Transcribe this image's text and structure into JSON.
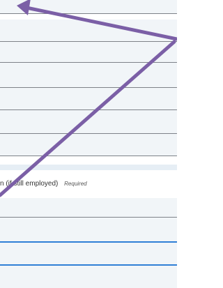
{
  "form": {
    "end_date_label": "(if still employed)",
    "end_date_label_prefix": "n",
    "required_text": "Required"
  },
  "annotation": {
    "arrow_color": "#7b5fa6"
  }
}
